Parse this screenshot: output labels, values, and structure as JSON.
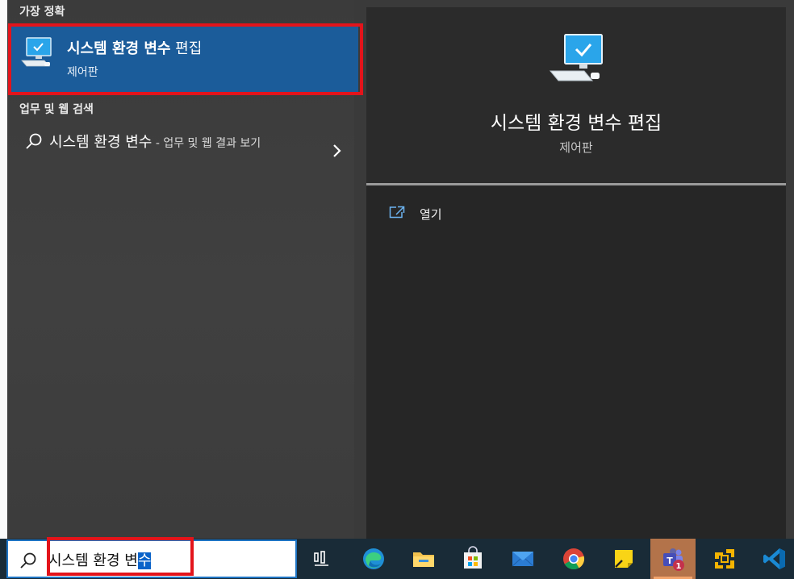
{
  "left": {
    "best_match_header": "가장 정확",
    "best_match": {
      "title_bold": "시스템 환경 변수",
      "title_rest": " 편집",
      "subtitle": "제어판",
      "icon": "computer-monitor-icon"
    },
    "web_header": "업무 및 웹 검색",
    "web_result": {
      "query": "시스템 환경 변수",
      "suffix": " - 업무 및 웹 결과 보기",
      "icon": "search-icon",
      "chevron": "chevron-right-icon"
    }
  },
  "right": {
    "title": "시스템 환경 변수 편집",
    "subtitle": "제어판",
    "open_label": "열기",
    "icon": "computer-monitor-icon"
  },
  "taskbar": {
    "search_text_plain": "시스템 환경 변",
    "search_text_selected": "수",
    "apps": [
      {
        "name": "task-view",
        "icon": "task-view-icon"
      },
      {
        "name": "edge",
        "icon": "edge-icon"
      },
      {
        "name": "file-explorer",
        "icon": "folder-icon"
      },
      {
        "name": "microsoft-store",
        "icon": "store-icon"
      },
      {
        "name": "mail",
        "icon": "mail-icon"
      },
      {
        "name": "chrome",
        "icon": "chrome-icon"
      },
      {
        "name": "sticky-notes",
        "icon": "sticky-notes-icon"
      },
      {
        "name": "teams",
        "icon": "teams-icon",
        "badge": "1"
      },
      {
        "name": "vmware",
        "icon": "vmware-icon"
      },
      {
        "name": "vscode",
        "icon": "vscode-icon"
      }
    ]
  },
  "colors": {
    "accent": "#1b5c9a",
    "highlight_outline": "#e3141b",
    "taskbar": "#192b37"
  }
}
